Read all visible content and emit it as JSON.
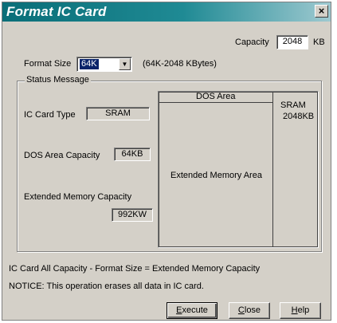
{
  "window": {
    "title": "Format IC Card",
    "close_glyph": "×"
  },
  "capacity": {
    "label": "Capacity",
    "value": "2048",
    "unit": "KB"
  },
  "format_size": {
    "label": "Format Size",
    "selected": "64K",
    "range_text": "(64K-2048 KBytes)"
  },
  "status": {
    "group_title": "Status Message",
    "card_type_label": "IC Card Type",
    "card_type_value": "SRAM",
    "dos_capacity_label": "DOS Area Capacity",
    "dos_capacity_value": "64KB",
    "ext_capacity_label": "Extended Memory Capacity",
    "ext_capacity_value": "992KW"
  },
  "diagram": {
    "dos_area": "DOS Area",
    "extended_area": "Extended Memory Area",
    "card_type": "SRAM",
    "card_size": "2048KB"
  },
  "notes": {
    "formula": "IC Card All Capacity - Format Size = Extended Memory Capacity",
    "notice": "NOTICE: This operation erases all data in IC card."
  },
  "buttons": {
    "execute_first": "E",
    "execute_rest": "xecute",
    "close_first": "C",
    "close_rest": "lose",
    "help_first": "H",
    "help_rest": "elp"
  }
}
